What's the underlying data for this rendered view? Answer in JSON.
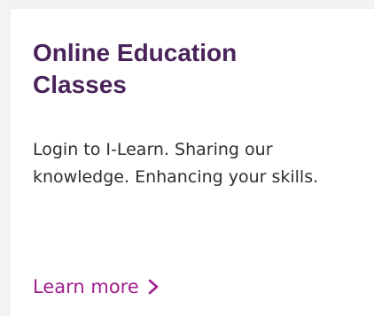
{
  "card": {
    "title": "Online Education Classes",
    "description": "Login to I-Learn. Sharing our knowledge. Enhancing your skills.",
    "link_label": "Learn more",
    "link_icon": "chevron-right-icon"
  },
  "colors": {
    "title": "#4a235a",
    "link": "#a01f8e",
    "text": "#2f2f2f",
    "background": "#f3f3f4",
    "card": "#ffffff"
  }
}
